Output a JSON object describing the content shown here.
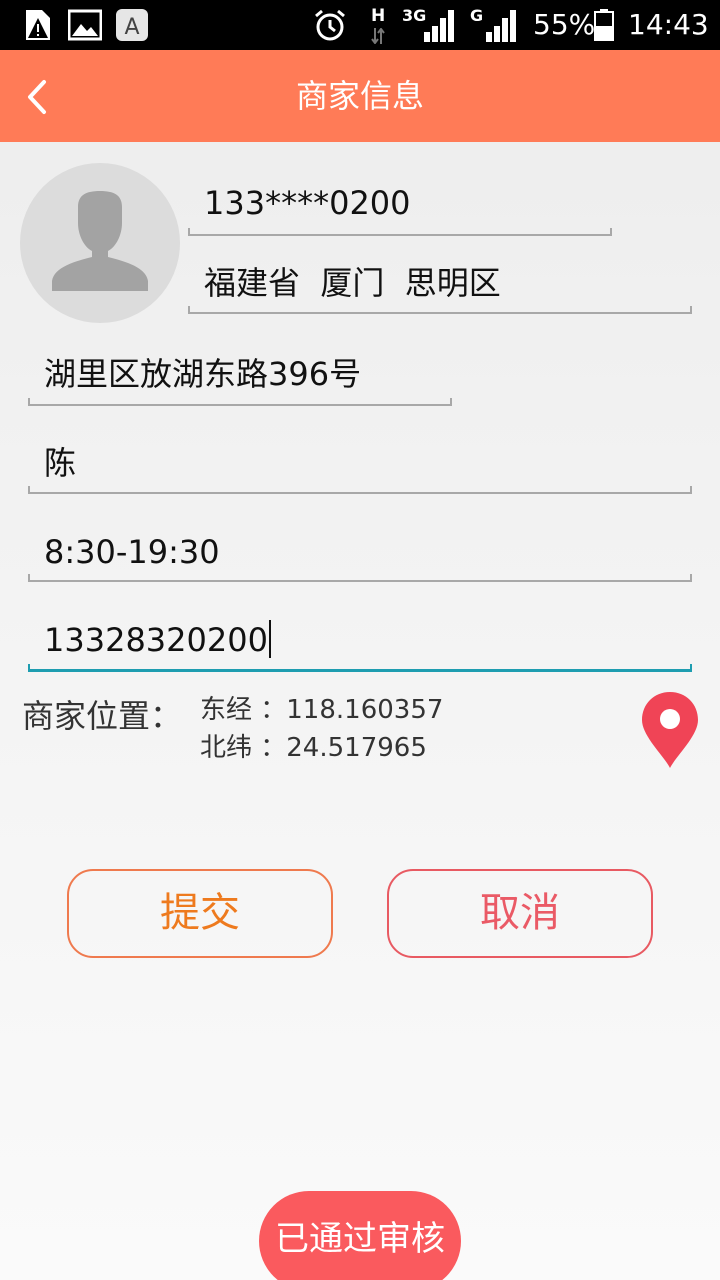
{
  "status_bar": {
    "battery": "55%",
    "time": "14:43",
    "network_h": "H",
    "network_3g": "3G",
    "network_g": "G",
    "icons": [
      "warning-file-icon",
      "image-icon",
      "font-app-icon",
      "alarm-icon",
      "signal-icon",
      "battery-icon"
    ]
  },
  "header": {
    "title": "商家信息",
    "back_icon": "chevron-left-icon"
  },
  "form": {
    "phone_masked": "133****0200",
    "region": "福建省  厦门  思明区",
    "address": "湖里区放湖东路396号",
    "contact": "陈",
    "hours": "8:30-19:30",
    "phone": "13328320200"
  },
  "location": {
    "label": "商家位置：",
    "longitude": "东经 ：118.160357",
    "latitude": "北纬 ：24.517965",
    "icon": "map-pin-icon"
  },
  "actions": {
    "submit_label": "提交",
    "cancel_label": "取消"
  },
  "review_status": "已通过审核",
  "colors": {
    "header_bg": "#ff7b57",
    "active_underline": "#1e9db0",
    "pin": "#f04456",
    "badge_bg": "#fa5a5e",
    "submit_text": "#ee7a1e",
    "cancel_text": "#ea5a66"
  }
}
